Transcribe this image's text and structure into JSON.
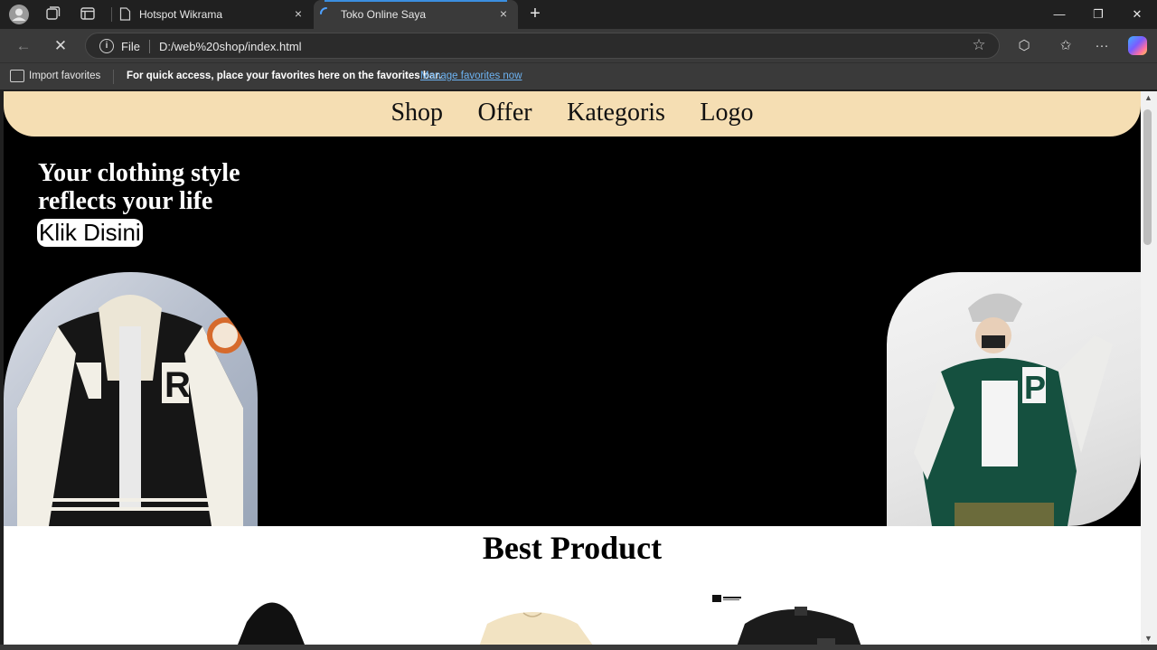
{
  "browser": {
    "tabs": [
      {
        "title": "Hotspot Wikrama"
      },
      {
        "title": "Toko Online Saya",
        "loading": true
      }
    ],
    "address": {
      "scheme_label": "File",
      "url": "D:/web%20shop/index.html"
    },
    "favorites_bar": {
      "import_label": "Import favorites",
      "message": "For quick access, place your favorites here on the favorites bar.",
      "manage_link": "Manage favorites now"
    },
    "icons": {
      "close": "×",
      "new_tab": "+",
      "minimize": "—",
      "restore": "❐",
      "window_close": "✕",
      "back": "←",
      "stop": "✕",
      "favorite": "☆",
      "extensions": "⬡",
      "favorites": "✩",
      "more": "···",
      "info": "i"
    }
  },
  "page": {
    "nav": [
      "Shop",
      "Offer",
      "Kategoris",
      "Logo"
    ],
    "hero": {
      "title": "Your clothing style reflects your life",
      "cta": "Klik Disini"
    },
    "section_title": "Best Product"
  },
  "colors": {
    "nav_bg": "#f5deb3",
    "hero_bg": "#000000",
    "accent_link": "#6db3f2"
  }
}
